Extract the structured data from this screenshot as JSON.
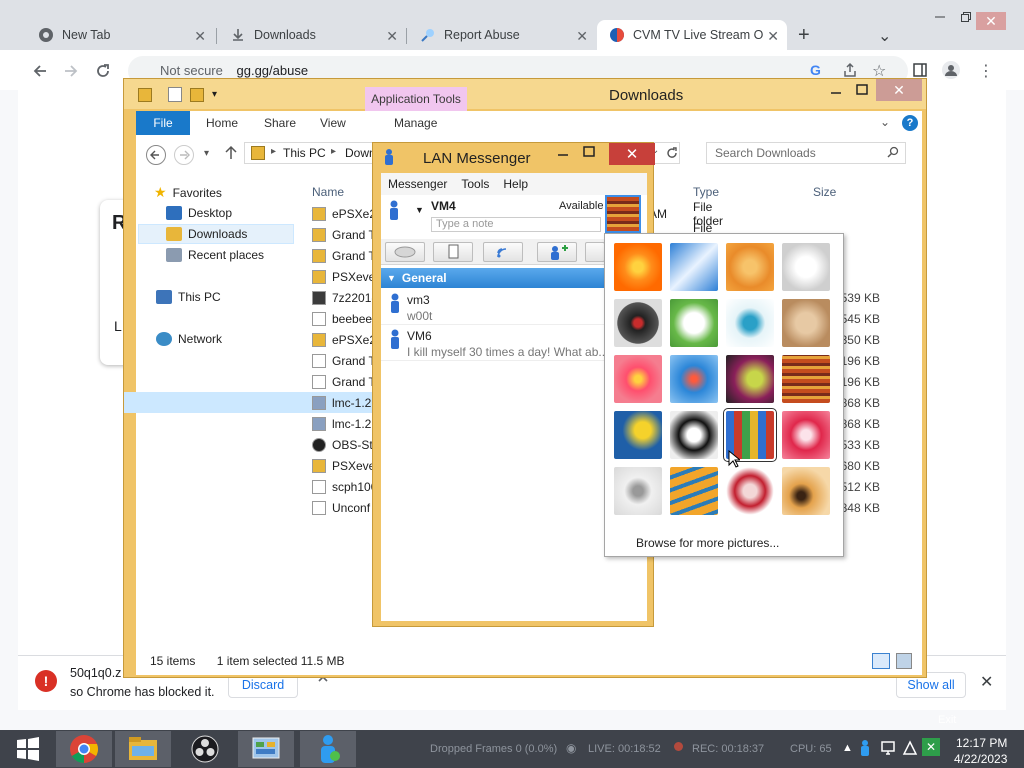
{
  "chrome": {
    "tabs": [
      {
        "label": "New Tab",
        "icon": "chrome-icon"
      },
      {
        "label": "Downloads",
        "icon": "download-icon"
      },
      {
        "label": "Report Abuse",
        "icon": "pin-icon"
      },
      {
        "label": "CVM TV Live Stream On",
        "icon": "cvm-icon"
      }
    ],
    "new_tab_symbol": "+",
    "tab_list_symbol": "⌄",
    "close_symbol": "✕",
    "address_security": "Not secure",
    "address_url": "gg.gg/abuse",
    "page_heading_letter": "R",
    "page_line_letter": "L",
    "download_file": "50q1q0.z",
    "download_blocked_msg": "so Chrome has blocked it.",
    "discard_label": "Discard",
    "show_all_label": "Show all"
  },
  "explorer": {
    "title": "Downloads",
    "app_tools_label": "Application Tools",
    "ribbon_tabs": [
      "File",
      "Home",
      "Share",
      "View",
      "Manage"
    ],
    "breadcrumb": [
      "This PC",
      "Down"
    ],
    "search_placeholder": "Search Downloads",
    "nav": {
      "favorites": "Favorites",
      "desktop": "Desktop",
      "downloads": "Downloads",
      "recent": "Recent places",
      "this_pc": "This PC",
      "network": "Network"
    },
    "columns": {
      "name": "Name",
      "type": "Type",
      "size": "Size"
    },
    "files": [
      {
        "name": "ePSXe2",
        "date_tail": "AM",
        "type": "File folder",
        "size": ""
      },
      {
        "name": "Grand T",
        "date_tail": "",
        "type": "File folder",
        "size": ""
      },
      {
        "name": "Grand T",
        "date_tail": "",
        "type": "",
        "size": ""
      },
      {
        "name": "PSXeve",
        "date_tail": "",
        "type": "",
        "size": ""
      },
      {
        "name": "7z2201-",
        "date_tail": "",
        "type": "",
        "size": "539 KB"
      },
      {
        "name": "beebee",
        "date_tail": "",
        "type": "",
        "size": "545 KB"
      },
      {
        "name": "ePSXe2",
        "date_tail": "",
        "type": "",
        "size": "350 KB"
      },
      {
        "name": "Grand T",
        "date_tail": "",
        "type": "",
        "size": "196 KB"
      },
      {
        "name": "Grand T",
        "date_tail": "",
        "type": "",
        "size": "196 KB"
      },
      {
        "name": "lmc-1.2",
        "date_tail": "",
        "type": "",
        "size": "868 KB"
      },
      {
        "name": "lmc-1.2",
        "date_tail": "",
        "type": "",
        "size": "868 KB"
      },
      {
        "name": "OBS-Stu",
        "date_tail": "",
        "type": "",
        "size": "533 KB"
      },
      {
        "name": "PSXeve",
        "date_tail": "",
        "type": "",
        "size": "680 KB"
      },
      {
        "name": "scph100",
        "date_tail": "",
        "type": "",
        "size": "512 KB"
      },
      {
        "name": "Unconf",
        "date_tail": "",
        "type": "",
        "size": "848 KB"
      }
    ],
    "status_items": "15 items",
    "status_selected": "1 item selected  11.5 MB"
  },
  "lan": {
    "title": "LAN Messenger",
    "menu": [
      "Messenger",
      "Tools",
      "Help"
    ],
    "user_name": "VM4",
    "status": "Available",
    "note_placeholder": "Type a note",
    "group_label": "General",
    "group_arrow": "▼",
    "contacts": [
      {
        "name": "vm3",
        "note": "w00t"
      },
      {
        "name": "VM6",
        "note": "I kill myself 30 times a day! What ab..."
      }
    ]
  },
  "picker": {
    "browse_label": "Browse for more pictures...",
    "pictures": [
      "orange-flower",
      "roller-coaster",
      "starfish",
      "robot-dog",
      "record-player",
      "lucky-cat",
      "gyroscope",
      "kitten",
      "pink-flower",
      "ferris-wheel",
      "ball",
      "fabric",
      "yellow-leaf",
      "border-collie",
      "crayons",
      "red-star",
      "jacks",
      "stairs",
      "paper-crane",
      "guitar"
    ]
  },
  "taskbar": {
    "obs_dropped": "Dropped Frames 0 (0.0%)",
    "obs_live": "LIVE: 00:18:52",
    "obs_rec": "REC: 00:18:37",
    "obs_cpu": "CPU: 65",
    "exit_label": "Exit",
    "time": "12:17 PM",
    "date": "4/22/2023"
  },
  "colors": {
    "explorer_frame": "#f0c467",
    "file_tab": "#1979ca",
    "app_tools": "#f1c6ef",
    "close_red": "#c7403a",
    "group_blue": "#2d84d4",
    "taskbar": "#3f434b"
  }
}
